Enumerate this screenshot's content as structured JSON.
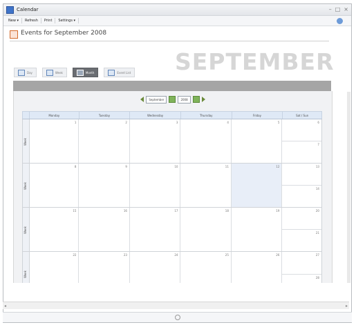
{
  "window": {
    "title": "Calendar"
  },
  "menu": {
    "items": [
      "New",
      "Refresh",
      "Print",
      "Settings"
    ]
  },
  "header": {
    "title": "Events for September 2008",
    "month_banner": "SEPTEMBER"
  },
  "tabs": [
    {
      "label": "Day",
      "active": false
    },
    {
      "label": "Week",
      "active": false
    },
    {
      "label": "Month",
      "active": true
    },
    {
      "label": "Event List",
      "active": false
    }
  ],
  "navigator": {
    "month": "September",
    "year": "2008"
  },
  "day_headers": [
    "Monday",
    "Tuesday",
    "Wednesday",
    "Thursday",
    "Friday",
    "Sat / Sun"
  ],
  "weeks": [
    {
      "label": "Week",
      "days": [
        "1",
        "2",
        "3",
        "4",
        "5"
      ],
      "sat": "6",
      "sun": "7"
    },
    {
      "label": "Week",
      "days": [
        "8",
        "9",
        "10",
        "11",
        "12"
      ],
      "sat": "13",
      "sun": "14"
    },
    {
      "label": "Week",
      "days": [
        "15",
        "16",
        "17",
        "18",
        "19"
      ],
      "sat": "20",
      "sun": "21"
    },
    {
      "label": "Week",
      "days": [
        "22",
        "23",
        "24",
        "25",
        "26"
      ],
      "sat": "27",
      "sun": "28"
    }
  ]
}
